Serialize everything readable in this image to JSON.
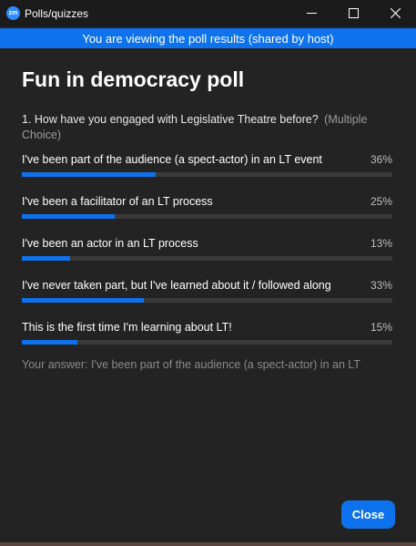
{
  "window": {
    "title": "Polls/quizzes",
    "app_icon_text": "zm",
    "controls": [
      "minimize-icon",
      "maximize-icon",
      "close-icon"
    ]
  },
  "banner": {
    "text": "You are viewing the poll results (shared by host)"
  },
  "poll": {
    "title": "Fun in democracy poll",
    "question": "1. How have you engaged with Legislative Theatre before?",
    "question_type": "(Multiple Choice)",
    "options": [
      {
        "label": "I've been part of the audience (a spect-actor) in an LT event",
        "percent_text": "36%",
        "percent": 36
      },
      {
        "label": "I've been a facilitator of an LT process",
        "percent_text": "25%",
        "percent": 25
      },
      {
        "label": "I've been an actor in an LT process",
        "percent_text": "13%",
        "percent": 13
      },
      {
        "label": "I've never taken part, but I've learned about it / followed along",
        "percent_text": "33%",
        "percent": 33
      },
      {
        "label": "This is the first time I'm learning about LT!",
        "percent_text": "15%",
        "percent": 15
      }
    ],
    "your_answer": "Your answer: I've been part of the audience (a spect-actor) in an LT"
  },
  "footer": {
    "close_label": "Close"
  },
  "colors": {
    "accent": "#0e72ed",
    "background": "#232323",
    "track": "#3a3a3a"
  }
}
